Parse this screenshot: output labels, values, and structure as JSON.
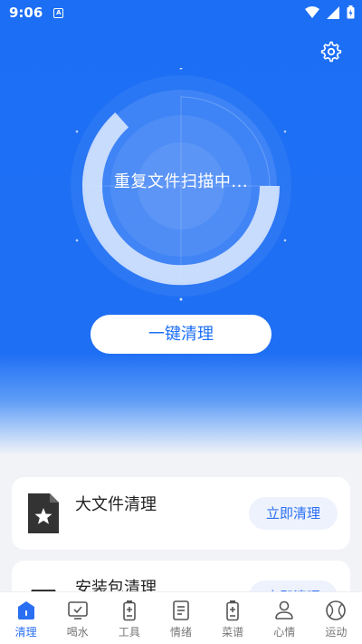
{
  "status": {
    "time": "9:06",
    "notif_glyph": "A"
  },
  "colors": {
    "primary": "#1c6ff5",
    "tab_active": "#2a6ff2",
    "tab_inactive": "#555555"
  },
  "scan": {
    "status_text": "重复文件扫描中..."
  },
  "actions": {
    "one_click_clean": "一键清理"
  },
  "cards": [
    {
      "title": "大文件清理",
      "button": "立即清理",
      "icon": "star-file-icon"
    },
    {
      "title": "安装包清理",
      "button": "立即清理",
      "icon": "package-box-icon"
    }
  ],
  "tabs": [
    {
      "label": "清理",
      "icon": "clean-home-icon",
      "active": true
    },
    {
      "label": "喝水",
      "icon": "water-monitor-icon",
      "active": false
    },
    {
      "label": "工具",
      "icon": "battery-tool-icon",
      "active": false
    },
    {
      "label": "情绪",
      "icon": "notes-icon",
      "active": false
    },
    {
      "label": "菜谱",
      "icon": "battery-plus-icon",
      "active": false
    },
    {
      "label": "心情",
      "icon": "person-icon",
      "active": false
    },
    {
      "label": "运动",
      "icon": "ball-icon",
      "active": false
    }
  ]
}
